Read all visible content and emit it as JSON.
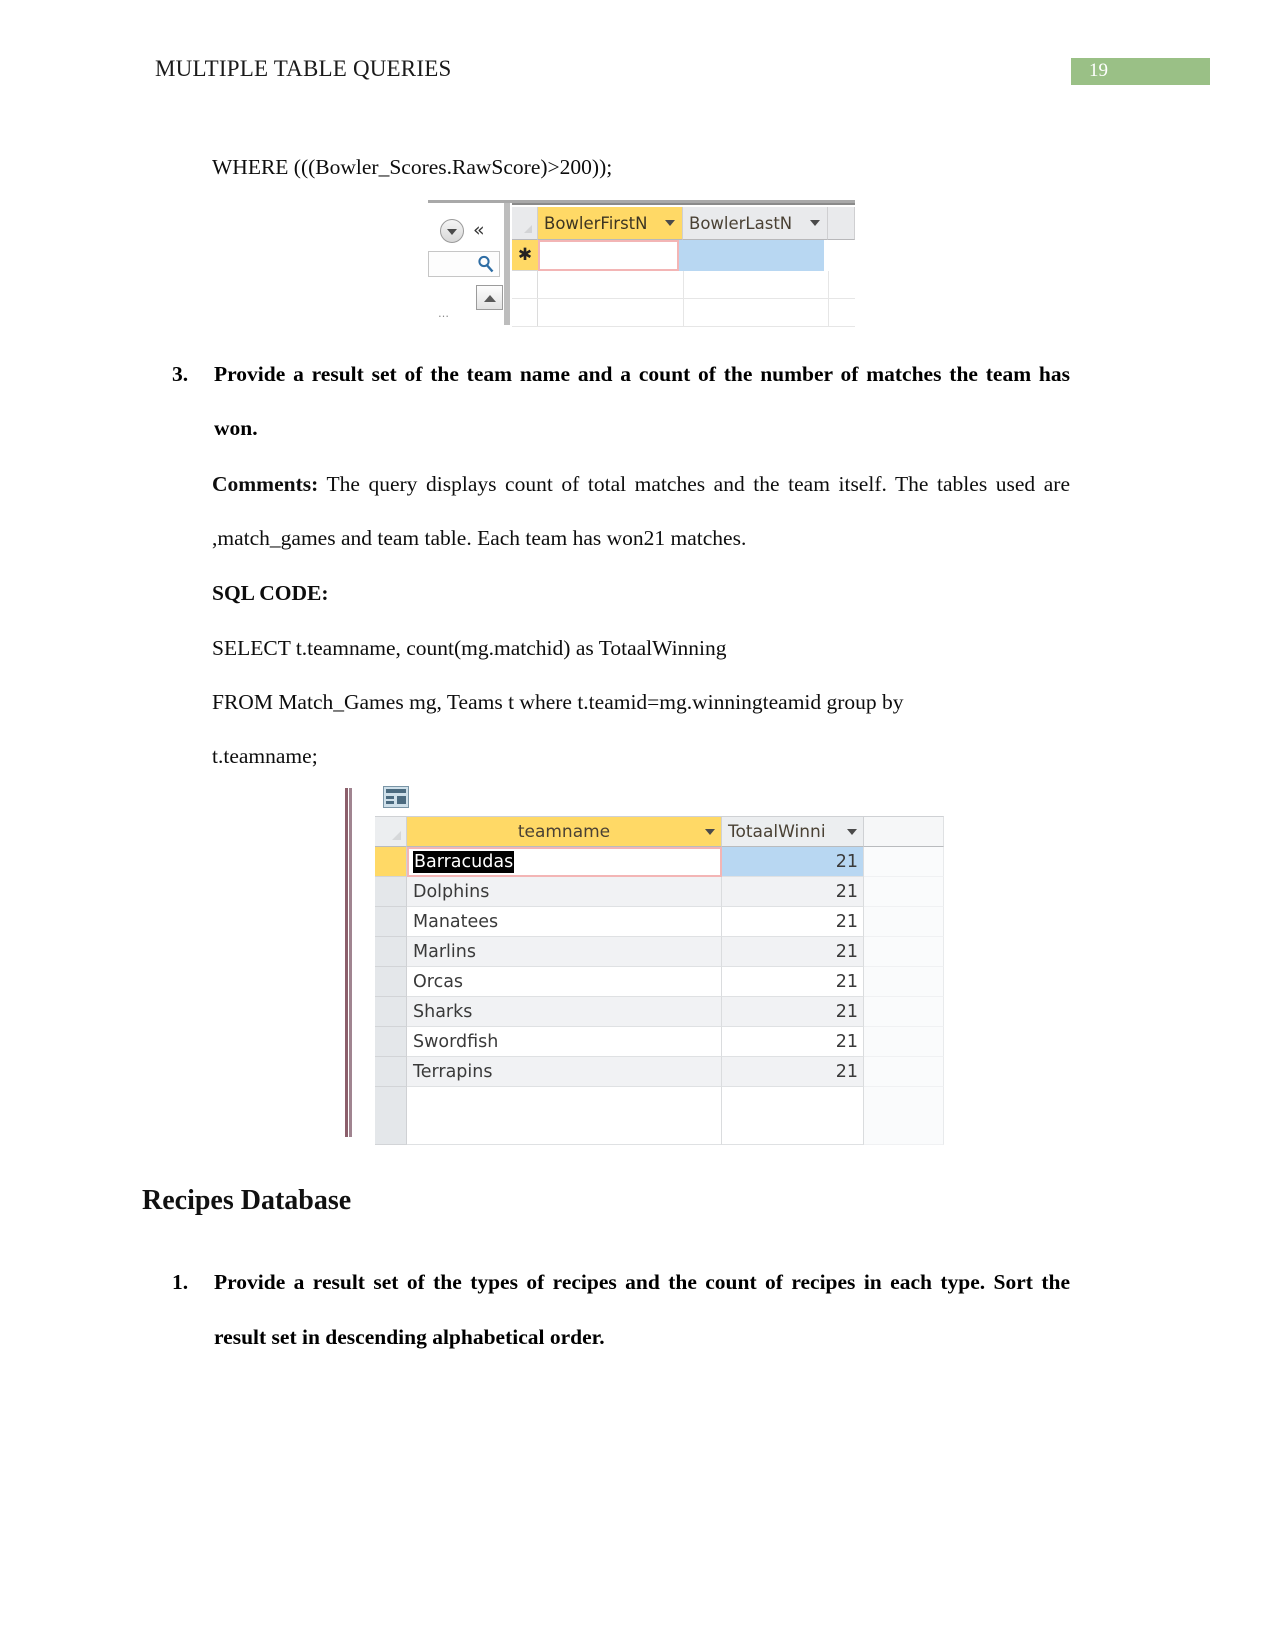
{
  "header": {
    "title": "MULTIPLE TABLE QUERIES",
    "page_number": "19",
    "accent_color": "#9ac086"
  },
  "body": {
    "where_line": "WHERE (((Bowler_Scores.RawScore)>200));",
    "item3": {
      "number": "3.",
      "text": "Provide a result set of the team name and a count of the number of matches the team has won."
    },
    "comments_label": "Comments:",
    "comments_text": " The query displays count of total matches and the team itself. The tables used are ,match_games and team table. Each team has won21 matches.",
    "sql_code_label": "SQL CODE:",
    "sql_line_1": "SELECT t.teamname, count(mg.matchid) as TotaalWinning",
    "sql_line_2": "FROM Match_Games mg, Teams t where t.teamid=mg.winningteamid group by",
    "sql_line_3": "t.teamname;",
    "section_heading": "Recipes Database",
    "item1": {
      "number": "1.",
      "text": "Provide a result set of the types of recipes and the count of recipes in each type. Sort the result set in descending alphabetical order."
    }
  },
  "screenshot_bowler": {
    "nav": {
      "dropdown_icon": "dropdown-circle-icon",
      "collapse_icon": "«",
      "search_icon": "search-icon",
      "up_icon": "up-arrow-icon",
      "dots": "…"
    },
    "columns": [
      {
        "label": "BowlerFirstN",
        "active": true
      },
      {
        "label": "BowlerLastN",
        "active": false
      }
    ],
    "new_row_marker": "✱"
  },
  "screenshot_results": {
    "icon": "datasheet-icon",
    "columns": [
      "teamname",
      "TotaalWinni"
    ],
    "rows": [
      {
        "teamname": "Barracudas",
        "count": "21",
        "current": true
      },
      {
        "teamname": "Dolphins",
        "count": "21",
        "current": false
      },
      {
        "teamname": "Manatees",
        "count": "21",
        "current": false
      },
      {
        "teamname": "Marlins",
        "count": "21",
        "current": false
      },
      {
        "teamname": "Orcas",
        "count": "21",
        "current": false
      },
      {
        "teamname": "Sharks",
        "count": "21",
        "current": false
      },
      {
        "teamname": "Swordfish",
        "count": "21",
        "current": false
      },
      {
        "teamname": "Terrapins",
        "count": "21",
        "current": false
      }
    ]
  }
}
